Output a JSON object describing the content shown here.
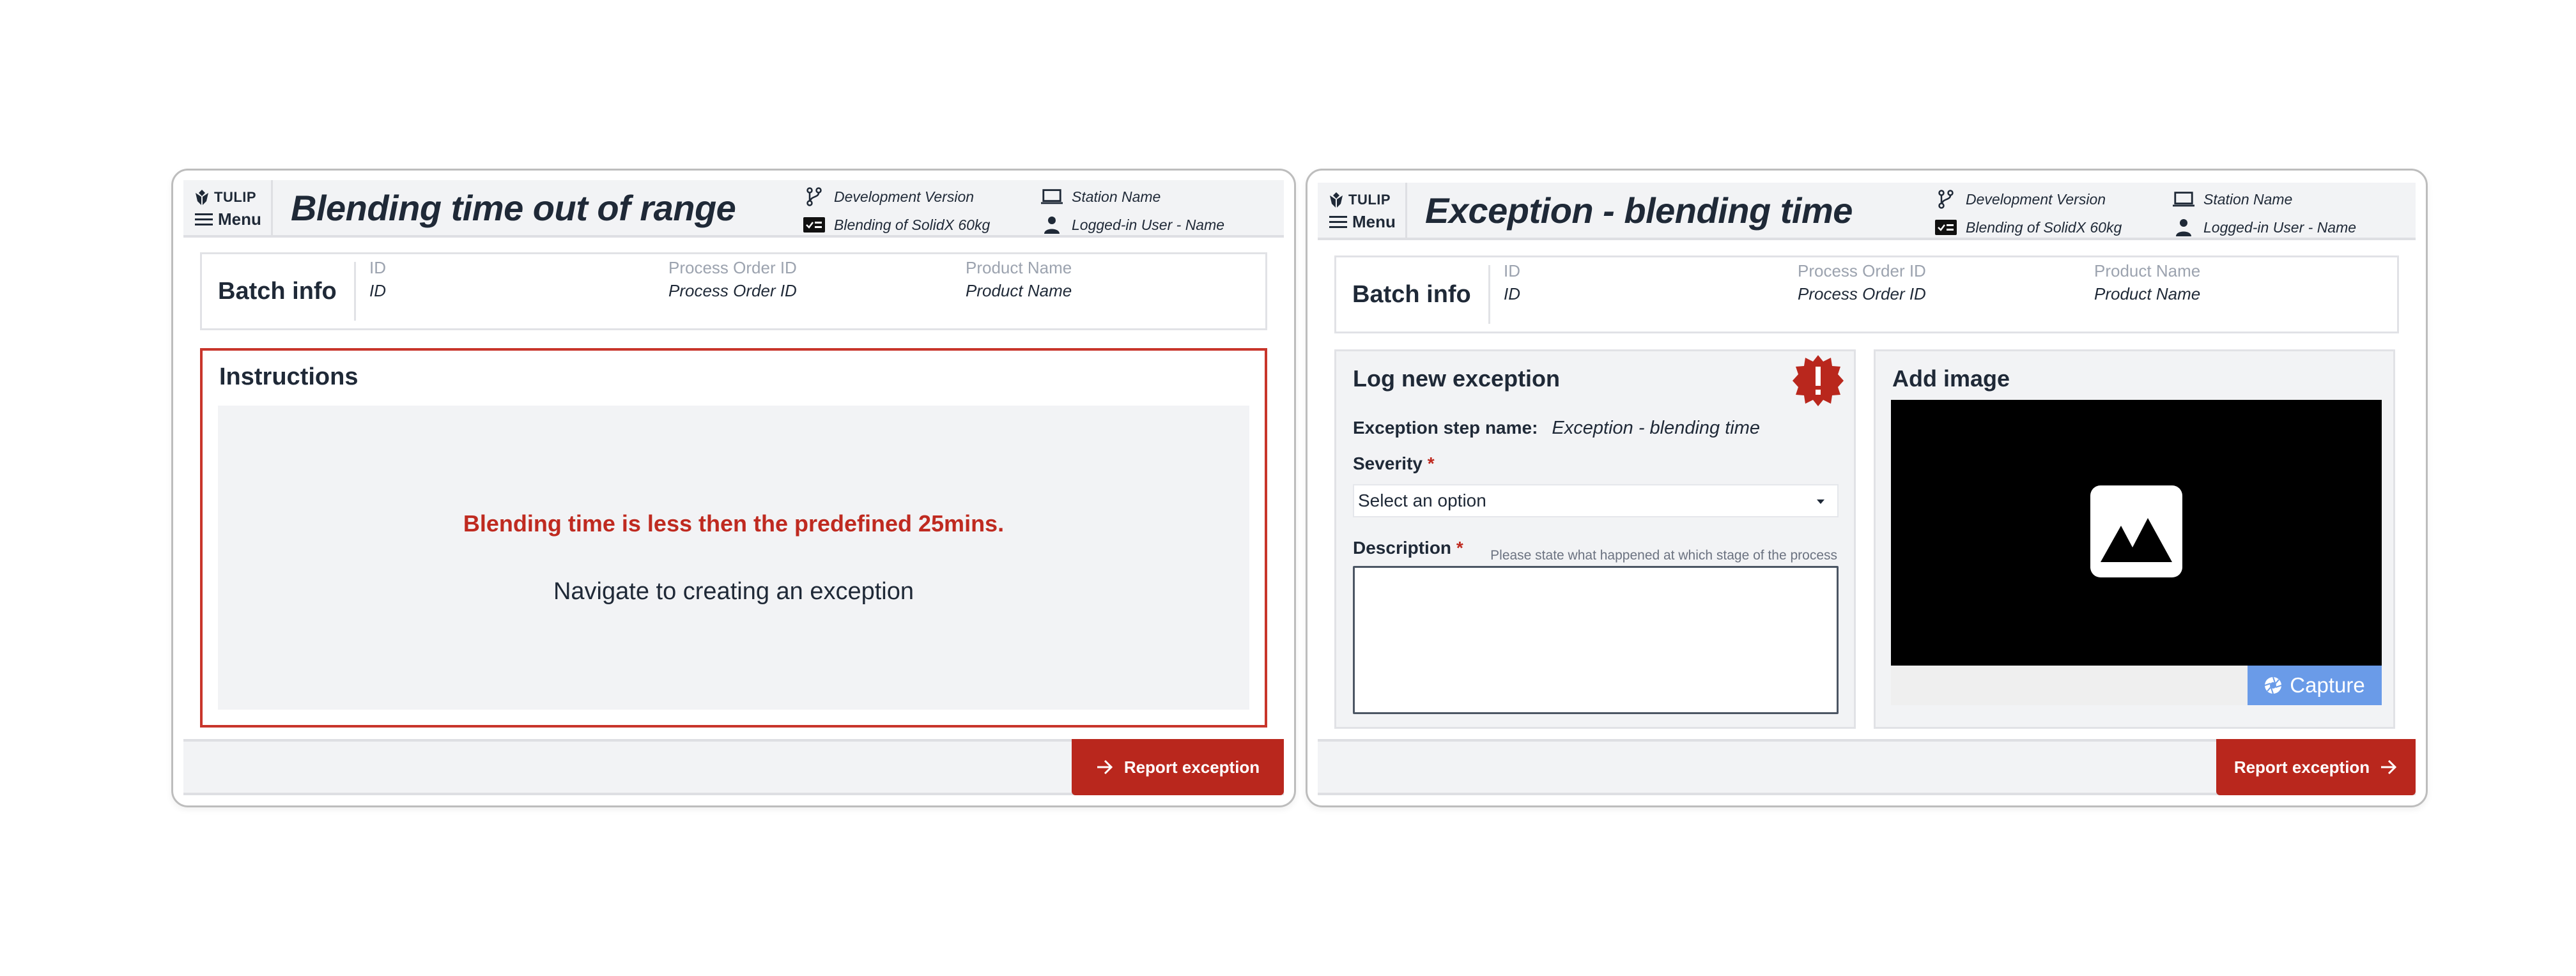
{
  "left_screen": {
    "brand": "TULIP",
    "menu_label": "Menu",
    "title": "Blending time out of range",
    "meta": {
      "version": "Development Version",
      "station": "Station Name",
      "process": "Blending of SolidX 60kg",
      "user": "Logged-in User - Name"
    },
    "batch": {
      "title": "Batch info",
      "columns": [
        {
          "label": "ID",
          "value": "ID"
        },
        {
          "label": "Process Order ID",
          "value": "Process Order ID"
        },
        {
          "label": "Product Name",
          "value": "Product Name"
        }
      ]
    },
    "instructions": {
      "title": "Instructions",
      "alert": "Blending time is less then the predefined 25mins.",
      "text": "Navigate to creating an exception"
    },
    "footer": {
      "button_label": "Report exception"
    }
  },
  "right_screen": {
    "brand": "TULIP",
    "menu_label": "Menu",
    "title": "Exception - blending time",
    "meta": {
      "version": "Development Version",
      "station": "Station Name",
      "process": "Blending of SolidX 60kg",
      "user": "Logged-in User - Name"
    },
    "batch": {
      "title": "Batch info",
      "columns": [
        {
          "label": "ID",
          "value": "ID"
        },
        {
          "label": "Process Order ID",
          "value": "Process Order ID"
        },
        {
          "label": "Product Name",
          "value": "Product Name"
        }
      ]
    },
    "log_panel": {
      "title": "Log new exception",
      "step_label": "Exception step name:",
      "step_value": "Exception - blending time",
      "severity_label": "Severity",
      "required_mark": "*",
      "severity_placeholder": "Select an option",
      "description_label": "Description",
      "description_hint": "Please state what happened at which stage of the process",
      "description_value": ""
    },
    "image_panel": {
      "title": "Add image",
      "capture_label": "Capture"
    },
    "footer": {
      "button_label": "Report exception"
    }
  },
  "colors": {
    "accent_red": "#b9271d",
    "alert_red": "#bf2a20",
    "capture_blue": "#6a9be8",
    "header_bg": "#f2f3f5"
  }
}
